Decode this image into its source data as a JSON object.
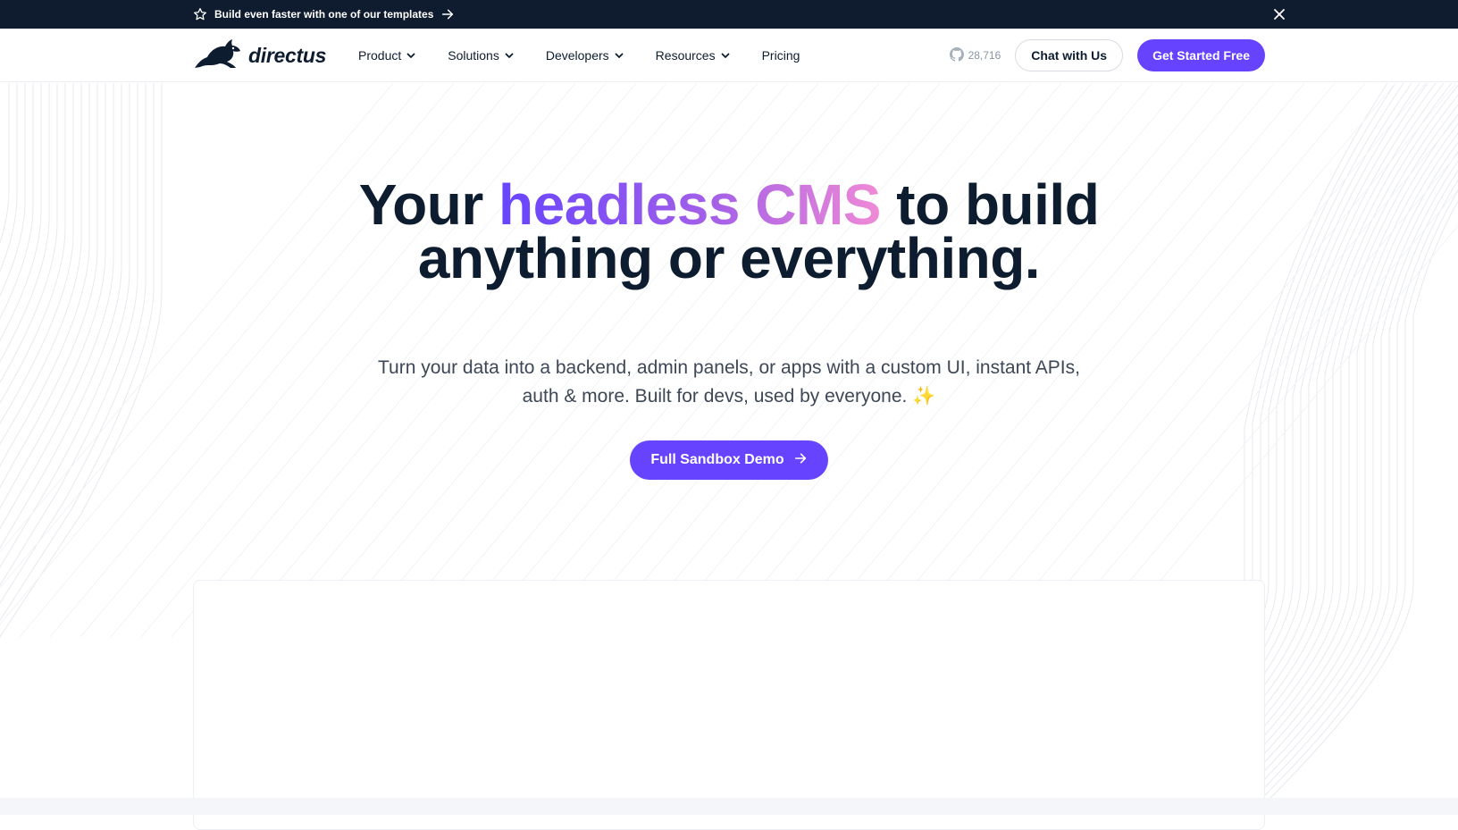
{
  "announcement": {
    "text": "Build even faster with one of our templates",
    "icon": "star-icon",
    "arrow_icon": "arrow-right-icon",
    "close_icon": "close-icon"
  },
  "nav": {
    "logo_text": "directus",
    "items": [
      {
        "label": "Product",
        "has_dropdown": true
      },
      {
        "label": "Solutions",
        "has_dropdown": true
      },
      {
        "label": "Developers",
        "has_dropdown": true
      },
      {
        "label": "Resources",
        "has_dropdown": true
      },
      {
        "label": "Pricing",
        "has_dropdown": false
      }
    ],
    "github_stars": "28,716",
    "chat_label": "Chat with Us",
    "cta_label": "Get Started Free"
  },
  "hero": {
    "headline_pre": "Your ",
    "headline_accent": "headless CMS",
    "headline_post": " to build anything or everything.",
    "subhead": "Turn your data into a backend, admin panels, or apps with a custom UI, instant APIs, auth & more. Built for devs, used by everyone.",
    "subhead_emoji": "✨",
    "cta_label": "Full Sandbox Demo"
  },
  "colors": {
    "brand_purple": "#6644ff",
    "gradient_end": "#f08ad6",
    "navy": "#0f1b2e"
  }
}
